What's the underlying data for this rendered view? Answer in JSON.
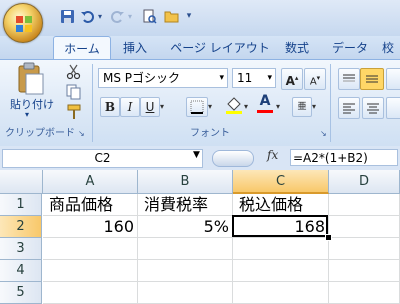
{
  "ribbon": {
    "tabs": [
      "ホーム",
      "挿入",
      "ページ レイアウト",
      "数式",
      "データ",
      "校"
    ],
    "paste_label": "貼り付け",
    "font_name": "MS Pゴシック",
    "font_size": "11",
    "bold": "B",
    "italic": "I",
    "underline": "U",
    "font_color_letter": "A",
    "group_clipboard": "クリップボード",
    "group_font": "フォント",
    "colors": {
      "highlight": "#ffff00",
      "font_color": "#ff0000"
    }
  },
  "formula_bar": {
    "name_box": "C2",
    "fx": "fx",
    "formula": "=A2*(1+B2)"
  },
  "sheet": {
    "columns": [
      "A",
      "B",
      "C",
      "D"
    ],
    "rows": [
      "1",
      "2",
      "3",
      "4",
      "5"
    ],
    "cells": {
      "A1": "商品価格",
      "B1": "消費税率",
      "C1": "税込価格",
      "A2": "160",
      "B2": "5%",
      "C2": "168"
    },
    "selected_cell": "C2"
  }
}
